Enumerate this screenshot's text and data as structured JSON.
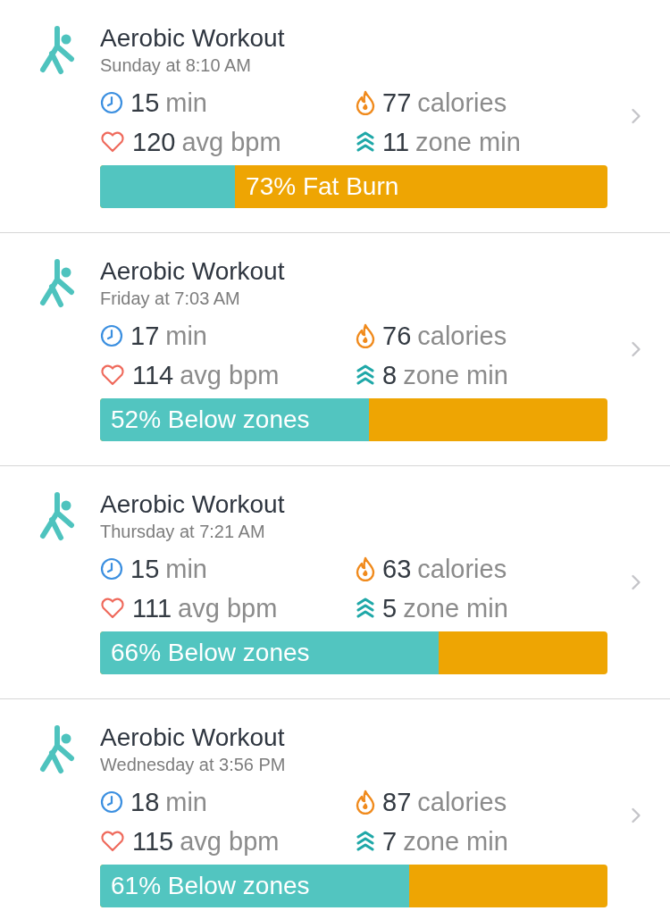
{
  "workouts": [
    {
      "title": "Aerobic Workout",
      "time": "Sunday at 8:10 AM",
      "stats": [
        {
          "kind": "duration",
          "value": "15",
          "unit": "min"
        },
        {
          "kind": "calories",
          "value": "77",
          "unit": "calories"
        },
        {
          "kind": "heart",
          "value": "120",
          "unit": "avg bpm"
        },
        {
          "kind": "zone",
          "value": "11",
          "unit": "zone min"
        }
      ],
      "bar": {
        "level": 0.266,
        "label": "73% Fat Burn",
        "label_in_fat_burn": true
      }
    },
    {
      "title": "Aerobic Workout",
      "time": "Friday at 7:03 AM",
      "stats": [
        {
          "kind": "duration",
          "value": "17",
          "unit": "min"
        },
        {
          "kind": "calories",
          "value": "76",
          "unit": "calories"
        },
        {
          "kind": "heart",
          "value": "114",
          "unit": "avg bpm"
        },
        {
          "kind": "zone",
          "value": "8",
          "unit": "zone min"
        }
      ],
      "bar": {
        "level": 0.53,
        "label": "52% Below zones",
        "label_in_fat_burn": false
      }
    },
    {
      "title": "Aerobic Workout",
      "time": "Thursday at 7:21 AM",
      "stats": [
        {
          "kind": "duration",
          "value": "15",
          "unit": "min"
        },
        {
          "kind": "calories",
          "value": "63",
          "unit": "calories"
        },
        {
          "kind": "heart",
          "value": "111",
          "unit": "avg bpm"
        },
        {
          "kind": "zone",
          "value": "5",
          "unit": "zone min"
        }
      ],
      "bar": {
        "level": 0.667,
        "label": "66% Below zones",
        "label_in_fat_burn": false
      }
    },
    {
      "title": "Aerobic Workout",
      "time": "Wednesday at 3:56 PM",
      "stats": [
        {
          "kind": "duration",
          "value": "18",
          "unit": "min"
        },
        {
          "kind": "calories",
          "value": "87",
          "unit": "calories"
        },
        {
          "kind": "heart",
          "value": "115",
          "unit": "avg bpm"
        },
        {
          "kind": "zone",
          "value": "7",
          "unit": "zone min"
        }
      ],
      "bar": {
        "level": 0.61,
        "label": "61% Below zones",
        "label_in_fat_burn": false
      }
    }
  ]
}
